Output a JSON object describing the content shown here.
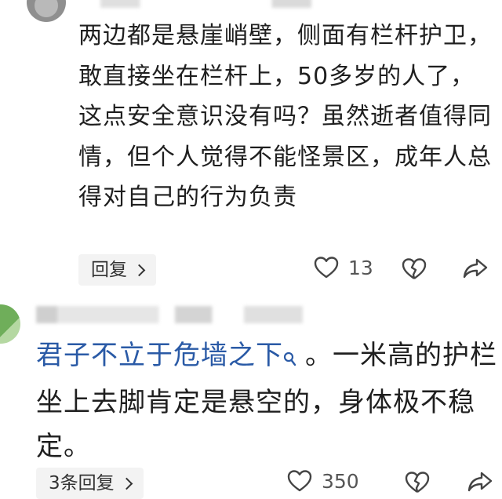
{
  "comments": [
    {
      "text": "两边都是悬崖峭壁，侧面有栏杆护卫，敢直接坐在栏杆上，50多岁的人了，这点安全意识没有吗？虽然逝者值得同情，但个人觉得不能怪景区，成年人总得对自己的行为负责",
      "reply_label": "回复",
      "like_count": "13"
    },
    {
      "link_text": "君子不立于危墙之下",
      "text_after": "。一米高的护栏坐上去脚肯定是悬空的，身体极不稳定。",
      "reply_label": "3条回复",
      "like_count": "350"
    }
  ],
  "icons": {
    "like": "heart-outline-icon",
    "dislike": "broken-heart-icon",
    "share": "share-arrow-icon",
    "search": "search-icon",
    "chevron": "chevron-right-icon"
  },
  "colors": {
    "link": "#2a5aa6",
    "text": "#1f1f1f",
    "muted": "#555555",
    "button_bg": "#f3f3f3"
  }
}
